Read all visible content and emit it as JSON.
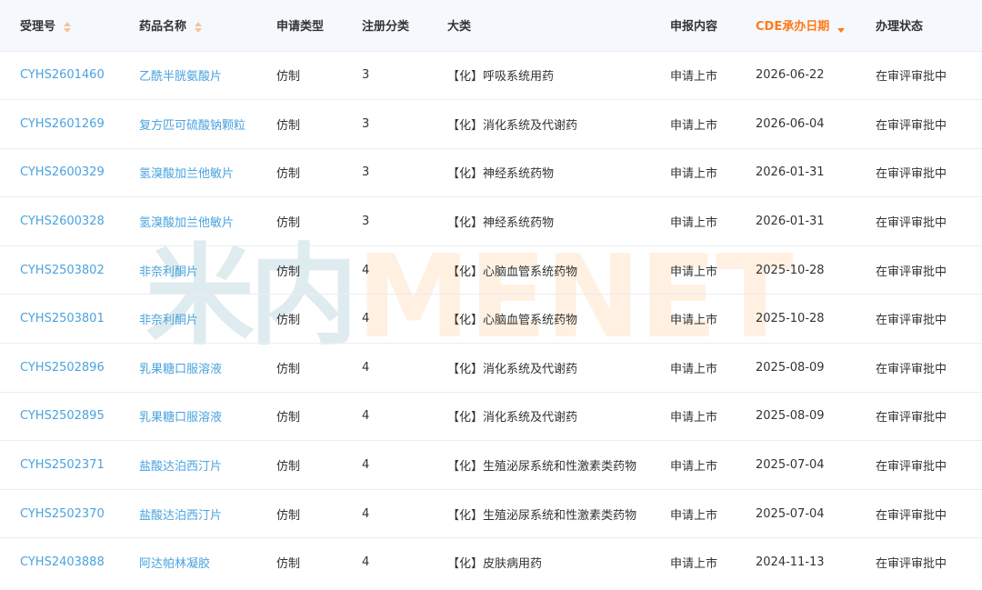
{
  "watermark": {
    "cn": "米内",
    "en": "MENET"
  },
  "table": {
    "headers": [
      "受理号",
      "药品名称",
      "申请类型",
      "注册分类",
      "大类",
      "申报内容",
      "CDE承办日期",
      "办理状态"
    ],
    "rows": [
      [
        "CYHS2601460",
        "乙酰半胱氨酸片",
        "仿制",
        "3",
        "【化】呼吸系统用药",
        "申请上市",
        "2026-06-22",
        "在审评审批中"
      ],
      [
        "CYHS2601269",
        "复方匹可硫酸钠颗粒",
        "仿制",
        "3",
        "【化】消化系统及代谢药",
        "申请上市",
        "2026-06-04",
        "在审评审批中"
      ],
      [
        "CYHS2600329",
        "氢溴酸加兰他敏片",
        "仿制",
        "3",
        "【化】神经系统药物",
        "申请上市",
        "2026-01-31",
        "在审评审批中"
      ],
      [
        "CYHS2600328",
        "氢溴酸加兰他敏片",
        "仿制",
        "3",
        "【化】神经系统药物",
        "申请上市",
        "2026-01-31",
        "在审评审批中"
      ],
      [
        "CYHS2503802",
        "非奈利酮片",
        "仿制",
        "4",
        "【化】心脑血管系统药物",
        "申请上市",
        "2025-10-28",
        "在审评审批中"
      ],
      [
        "CYHS2503801",
        "非奈利酮片",
        "仿制",
        "4",
        "【化】心脑血管系统药物",
        "申请上市",
        "2025-10-28",
        "在审评审批中"
      ],
      [
        "CYHS2502896",
        "乳果糖口服溶液",
        "仿制",
        "4",
        "【化】消化系统及代谢药",
        "申请上市",
        "2025-08-09",
        "在审评审批中"
      ],
      [
        "CYHS2502895",
        "乳果糖口服溶液",
        "仿制",
        "4",
        "【化】消化系统及代谢药",
        "申请上市",
        "2025-08-09",
        "在审评审批中"
      ],
      [
        "CYHS2502371",
        "盐酸达泊西汀片",
        "仿制",
        "4",
        "【化】生殖泌尿系统和性激素类药物",
        "申请上市",
        "2025-07-04",
        "在审评审批中"
      ],
      [
        "CYHS2502370",
        "盐酸达泊西汀片",
        "仿制",
        "4",
        "【化】生殖泌尿系统和性激素类药物",
        "申请上市",
        "2025-07-04",
        "在审评审批中"
      ],
      [
        "CYHS2403888",
        "阿达帕林凝胶",
        "仿制",
        "4",
        "【化】皮肤病用药",
        "申请上市",
        "2024-11-13",
        "在审评审批中"
      ]
    ]
  },
  "colors": {
    "link": "#4aa3df",
    "active_sort": "#ff7a1a",
    "header_bg": "#f5f9fd"
  }
}
